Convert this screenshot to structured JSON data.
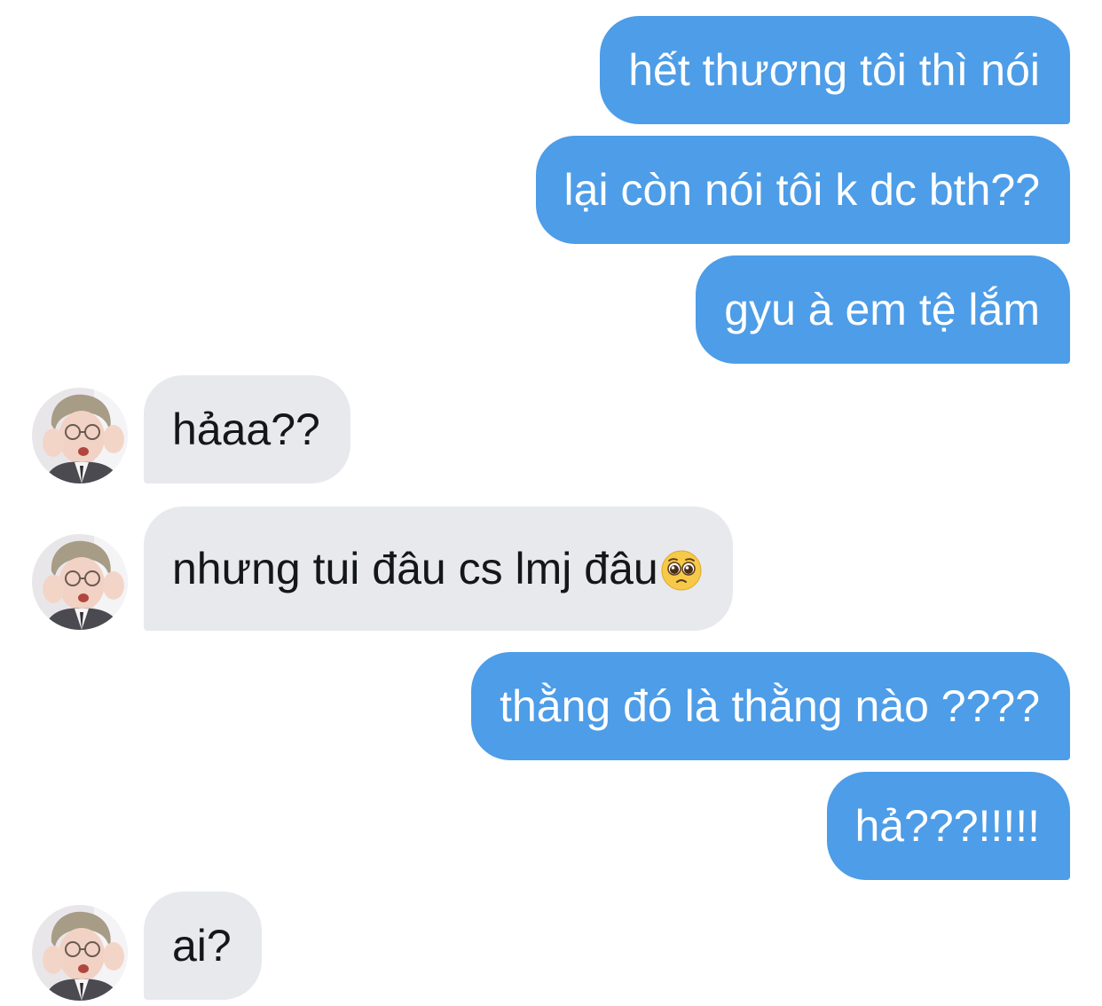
{
  "messages": [
    {
      "side": "sent",
      "text": "hết thương tôi thì nói"
    },
    {
      "side": "sent",
      "text": "lại còn nói tôi k dc bth??"
    },
    {
      "side": "sent",
      "text": "gyu à em tệ lắm"
    },
    {
      "side": "received",
      "text": "hảaa??"
    },
    {
      "side": "received",
      "text": "nhưng tui đâu cs lmj đâu",
      "emoji": "pleading-face-emoji"
    },
    {
      "side": "sent",
      "text": "thằng đó là thằng nào ????"
    },
    {
      "side": "sent",
      "text": "hả???!!!!!"
    },
    {
      "side": "received",
      "text": "ai?"
    }
  ],
  "colors": {
    "sent_bubble": "#4d9de8",
    "received_bubble": "#e7e9ed",
    "sent_text": "#ffffff",
    "received_text": "#14171a",
    "background": "#ffffff"
  }
}
